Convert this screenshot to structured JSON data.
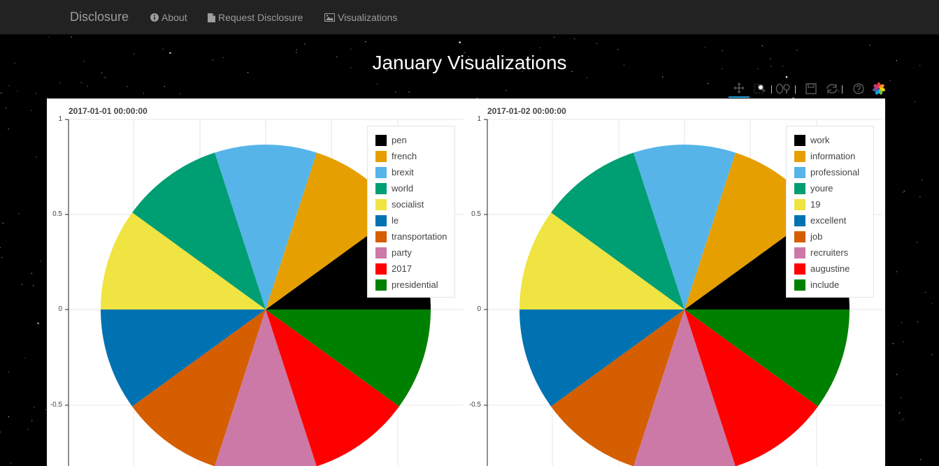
{
  "navbar": {
    "brand": "Disclosure",
    "items": [
      {
        "label": "About",
        "icon": "info-icon"
      },
      {
        "label": "Request Disclosure",
        "icon": "file-icon"
      },
      {
        "label": "Visualizations",
        "icon": "picture-icon"
      }
    ]
  },
  "page": {
    "title": "January Visualizations"
  },
  "toolbar": {
    "tools": [
      "pan-icon",
      "box-zoom-icon",
      "wheel-zoom-icon",
      "save-icon",
      "reset-icon",
      "help-icon",
      "bokeh-logo-icon"
    ]
  },
  "colors": [
    "#000000",
    "#E69F00",
    "#56B4E9",
    "#009E73",
    "#F0E442",
    "#0072B2",
    "#D55E00",
    "#CC79A7",
    "#FF0000",
    "#008000"
  ],
  "chart_data": [
    {
      "type": "pie",
      "title": "2017-01-01 00:00:00",
      "categories": [
        "pen",
        "french",
        "brexit",
        "world",
        "socialist",
        "le",
        "transportation",
        "party",
        "2017",
        "presidential"
      ],
      "values": [
        1,
        1,
        1,
        1,
        1,
        1,
        1,
        1,
        1,
        1
      ],
      "yticks": [
        "1",
        "0.5",
        "0",
        "-0.5"
      ],
      "legend_position": "top-right",
      "grid": true
    },
    {
      "type": "pie",
      "title": "2017-01-02 00:00:00",
      "categories": [
        "work",
        "information",
        "professional",
        "youre",
        "19",
        "excellent",
        "job",
        "recruiters",
        "augustine",
        "include"
      ],
      "values": [
        1,
        1,
        1,
        1,
        1,
        1,
        1,
        1,
        1,
        1
      ],
      "yticks": [
        "1",
        "0.5",
        "0",
        "-0.5"
      ],
      "legend_position": "top-right",
      "grid": true
    }
  ]
}
